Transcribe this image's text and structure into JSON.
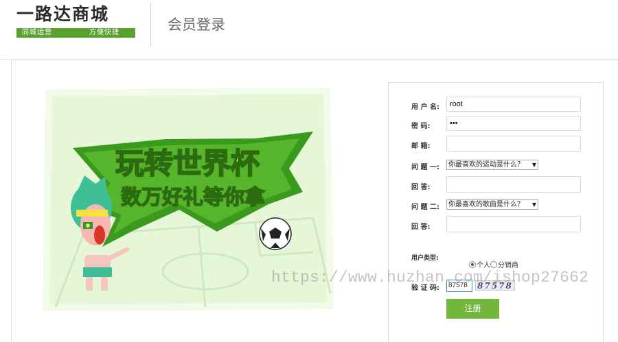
{
  "logo": {
    "title": "一路达商城",
    "tagline_left": "同城运营",
    "tagline_right": "方便快捷"
  },
  "header": {
    "page_title": "会员登录"
  },
  "banner": {
    "headline": "玩转世界杯",
    "subline": "数万好礼等你拿"
  },
  "form": {
    "username": {
      "label": "用 户 名:",
      "value": "root"
    },
    "password": {
      "label": "密    码:",
      "value": "•••"
    },
    "email": {
      "label": "邮    箱:",
      "value": ""
    },
    "question1": {
      "label": "问 题 一:",
      "selected": "你最喜欢的运动是什么？"
    },
    "answer1": {
      "label": "回    答:",
      "value": ""
    },
    "question2": {
      "label": "问 题 二:",
      "selected": "你最喜欢的歌曲是什么？"
    },
    "answer2": {
      "label": "回    答:",
      "value": ""
    },
    "user_type": {
      "label": "用户类型:",
      "options": [
        "个人",
        "分销商"
      ],
      "selected": "个人"
    },
    "captcha": {
      "label": "验 证 码:",
      "value": "87578",
      "image_text": "87578"
    },
    "submit_label": "注册"
  },
  "watermark": "https://www.huzhan.com/ishop27662",
  "colors": {
    "accent_green": "#72b73c",
    "logo_green": "#5aa230"
  }
}
